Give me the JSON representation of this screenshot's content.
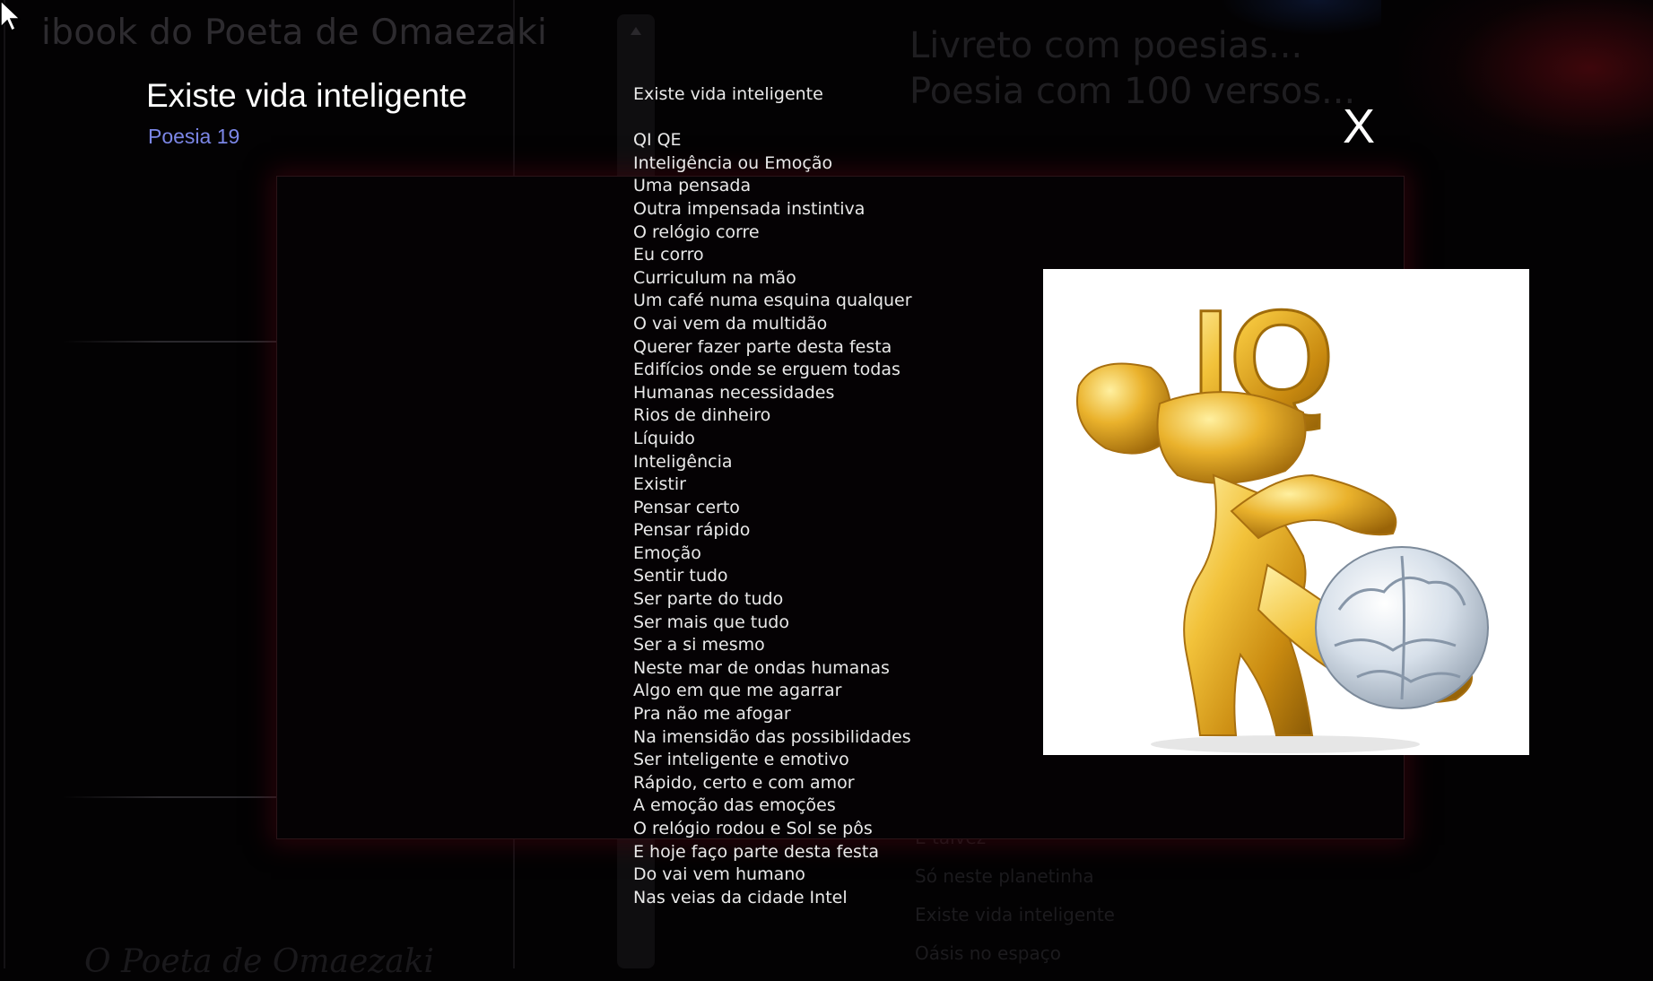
{
  "background": {
    "site_title": "ibook do Poeta de Omaezaki",
    "book_heading_lines": [
      "Livreto com poesias...",
      "Poesia com 100 versos..."
    ],
    "poem_index": [
      "E talvez",
      "Só neste planetinha",
      "Existe vida inteligente",
      "Oásis no espaço"
    ],
    "footer_brand": "O Poeta de Omaezaki"
  },
  "lightbox": {
    "title": "Existe vida inteligente",
    "subtitle": "Poesia 19",
    "close_label": "X",
    "poem_heading": "Existe vida inteligente",
    "verses": [
      "QI QE",
      "Inteligência ou Emoção",
      "Uma pensada",
      "Outra impensada instintiva",
      "O relógio corre",
      "Eu corro",
      "Curriculum na mão",
      "Um café numa esquina qualquer",
      "O vai vem da multidão",
      "Querer fazer parte desta festa",
      "Edifícios onde se erguem todas",
      "Humanas necessidades",
      "Rios de dinheiro",
      "Líquido",
      "Inteligência",
      "Existir",
      "Pensar certo",
      "Pensar rápido",
      "Emoção",
      "Sentir tudo",
      "Ser parte do tudo",
      "Ser mais que tudo",
      "Ser a si mesmo",
      "Neste mar de ondas humanas",
      "Algo em que me agarrar",
      "Pra não me afogar",
      "Na imensidão das possibilidades",
      "Ser inteligente e emotivo",
      "Rápido, certo e com amor",
      "A emoção das emoções",
      "O relógio rodou e Sol se pôs",
      "E hoje faço parte desta festa",
      "Do vai vem humano",
      "Nas veias da cidade Intel"
    ],
    "illustration": {
      "text": "IQ",
      "icon": "golden-figure-holding-brain",
      "colors": {
        "gold": "#e8b020",
        "brain": "#c8d4e0",
        "background": "#ffffff"
      }
    }
  },
  "colors": {
    "overlay_background": "#030203",
    "frame_glow": "#46060e",
    "subtitle": "#7b86e6",
    "text": "#e9e9e9"
  }
}
